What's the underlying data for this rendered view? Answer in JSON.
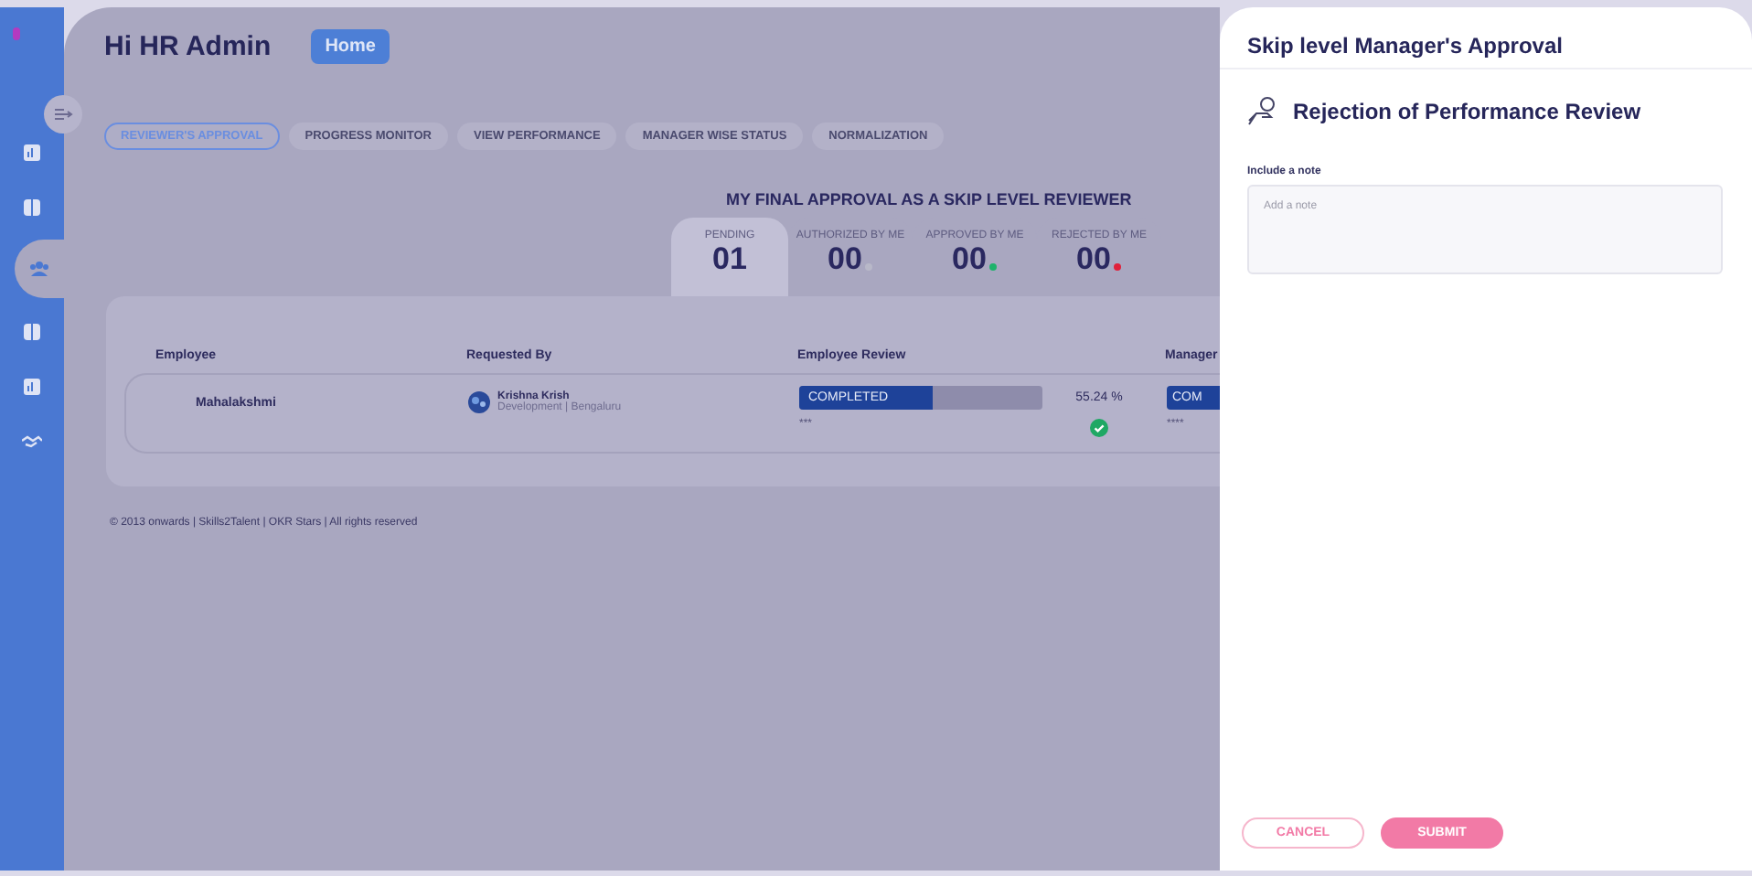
{
  "sidebar": {
    "items": [
      {
        "selected": false
      },
      {
        "selected": false
      },
      {
        "selected": true
      },
      {
        "selected": false
      },
      {
        "selected": false
      },
      {
        "selected": false
      }
    ]
  },
  "header": {
    "greeting": "Hi HR Admin",
    "home_button": "Home"
  },
  "tabs": [
    {
      "label": "REVIEWER'S APPROVAL",
      "selected": true
    },
    {
      "label": "PROGRESS MONITOR",
      "selected": false
    },
    {
      "label": "VIEW PERFORMANCE",
      "selected": false
    },
    {
      "label": "MANAGER WISE STATUS",
      "selected": false
    },
    {
      "label": "NORMALIZATION",
      "selected": false
    }
  ],
  "summary": {
    "title": "MY FINAL APPROVAL AS A SKIP LEVEL REVIEWER",
    "stats": [
      {
        "label": "PENDING",
        "value": "01",
        "selected": true
      },
      {
        "label": "AUTHORIZED BY ME",
        "value": "00",
        "selected": false,
        "color": "#b8b8c8"
      },
      {
        "label": "APPROVED BY ME",
        "value": "00",
        "selected": false,
        "color": "#1fb36b"
      },
      {
        "label": "REJECTED BY ME",
        "value": "00",
        "selected": false,
        "color": "#e0203a"
      }
    ]
  },
  "table": {
    "columns": [
      "Employee",
      "Requested By",
      "Employee Review",
      "Manager"
    ],
    "rows": [
      {
        "employee": "Mahalakshmi",
        "requester": "Krishna Krish",
        "requester_detail": "Development | Bengaluru",
        "review": {
          "status": "COMPLETED",
          "level": 0.55,
          "percent": "55.24 %",
          "rating": "***",
          "done": true
        },
        "manager": {
          "status": "COM",
          "rating": "****"
        }
      }
    ]
  },
  "footer": "© 2013 onwards | Skills2Talent | OKR Stars | All rights reserved",
  "drawer": {
    "title": "Skip level Manager's Approval",
    "heading": "Rejection of Performance Review",
    "note_label": "Include a note",
    "note_placeholder": "Add a note",
    "buttons": [
      {
        "label": "CANCEL",
        "kind": "secondary"
      },
      {
        "label": "SUBMIT",
        "kind": "primary"
      }
    ]
  }
}
